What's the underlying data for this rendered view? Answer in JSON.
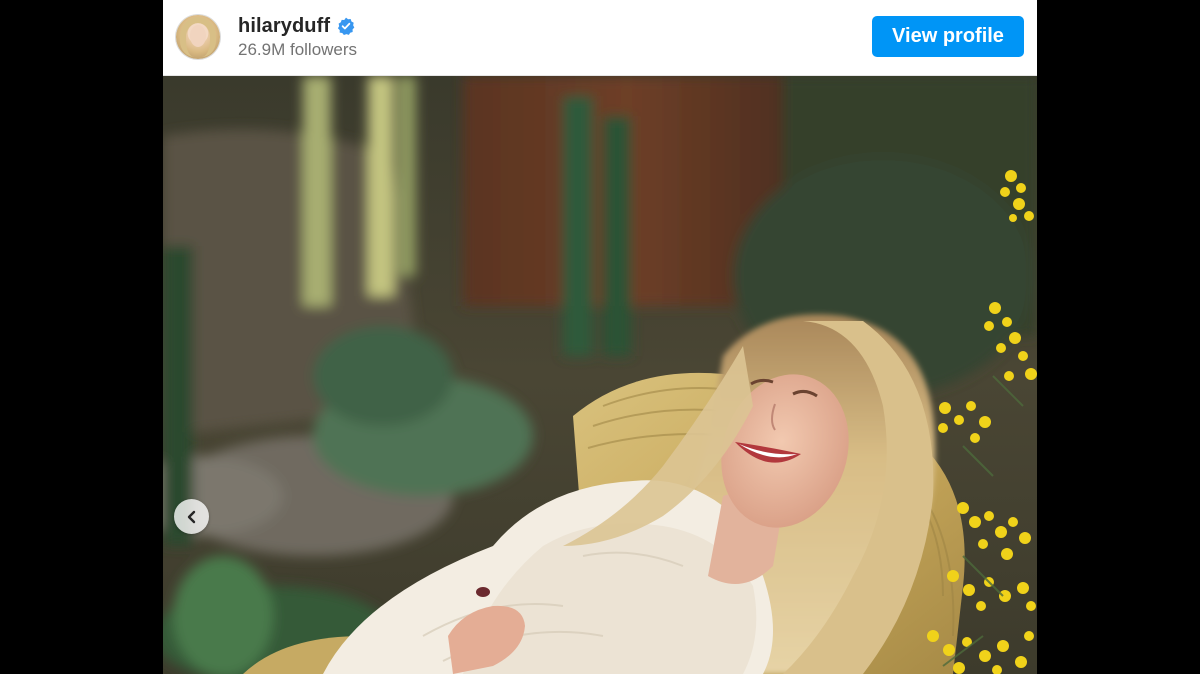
{
  "post": {
    "username": "hilaryduff",
    "followers": "26.9M followers",
    "verified_icon": "verified-badge-icon",
    "avatar_icon": "profile-avatar"
  },
  "actions": {
    "view_profile_label": "View profile"
  },
  "carousel": {
    "prev_icon": "chevron-left-icon"
  },
  "colors": {
    "page_background": "#000000",
    "embed_background": "#ffffff",
    "primary_button": "#0095f6",
    "verified_badge": "#3897f0",
    "username_text": "#262626",
    "secondary_text": "#737373"
  }
}
